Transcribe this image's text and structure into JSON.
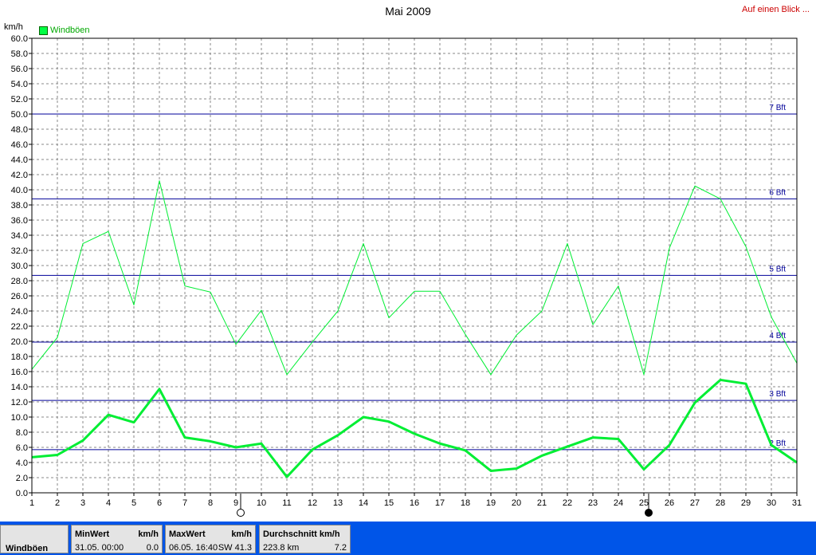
{
  "title": "Mai 2009",
  "link_label": "Auf einen Blick ...",
  "unit_label": "km/h",
  "legend_label": "Windböen",
  "footer": {
    "name": "Windböen",
    "min": {
      "header": "MinWert",
      "unit": "km/h",
      "date": "31.05.  00:00",
      "value": "0.0"
    },
    "max": {
      "header": "MaxWert",
      "unit": "km/h",
      "date": "06.05.  16:40",
      "value": "SW 41.3"
    },
    "avg": {
      "header": "Durchschnitt km/h",
      "distance": "223.8 km",
      "value": "7.2"
    }
  },
  "colors": {
    "series": "#00ee33",
    "beaufort": "#000099",
    "grid": "#777777",
    "footer": "#0055e8"
  },
  "moon_icons": [
    "full-moon-icon",
    "new-moon-icon"
  ],
  "chart_data": {
    "type": "line",
    "title": "Mai 2009",
    "ylabel": "km/h",
    "ylim": [
      0,
      60
    ],
    "y_ticks": [
      "0.0",
      "2.0",
      "4.0",
      "6.0",
      "8.0",
      "10.0",
      "12.0",
      "14.0",
      "16.0",
      "18.0",
      "20.0",
      "22.0",
      "24.0",
      "26.0",
      "28.0",
      "30.0",
      "32.0",
      "34.0",
      "36.0",
      "38.0",
      "40.0",
      "42.0",
      "44.0",
      "46.0",
      "48.0",
      "50.0",
      "52.0",
      "54.0",
      "56.0",
      "58.0",
      "60.0"
    ],
    "x": [
      1,
      2,
      3,
      4,
      5,
      6,
      7,
      8,
      9,
      10,
      11,
      12,
      13,
      14,
      15,
      16,
      17,
      18,
      19,
      20,
      21,
      22,
      23,
      24,
      25,
      26,
      27,
      28,
      29,
      30,
      31
    ],
    "grid": true,
    "series": [
      {
        "name": "Windböen",
        "style": "thin",
        "values": [
          16.3,
          20.5,
          32.9,
          34.5,
          24.8,
          41.2,
          27.3,
          26.5,
          19.6,
          24.1,
          15.6,
          19.9,
          24.0,
          32.9,
          23.1,
          26.6,
          26.6,
          20.9,
          15.6,
          20.8,
          24.0,
          32.9,
          22.2,
          27.3,
          15.6,
          32.3,
          40.5,
          38.8,
          32.5,
          23.2,
          17.1
        ]
      },
      {
        "style": "thick",
        "values": [
          4.7,
          5.0,
          6.9,
          10.3,
          9.3,
          13.7,
          7.3,
          6.8,
          6.0,
          6.5,
          2.1,
          5.7,
          7.6,
          10.0,
          9.4,
          7.8,
          6.5,
          5.6,
          2.9,
          3.2,
          4.9,
          6.1,
          7.3,
          7.1,
          3.1,
          6.3,
          11.9,
          14.9,
          14.4,
          6.3,
          4.0
        ]
      }
    ],
    "beaufort_lines": [
      {
        "label": "2 Bft",
        "value": 5.7
      },
      {
        "label": "3 Bft",
        "value": 12.2
      },
      {
        "label": "4 Bft",
        "value": 19.9
      },
      {
        "label": "5 Bft",
        "value": 28.7
      },
      {
        "label": "6 Bft",
        "value": 38.8
      },
      {
        "label": "7 Bft",
        "value": 50.0
      }
    ],
    "moon_markers": [
      {
        "day": 9,
        "phase": "full"
      },
      {
        "day": 25,
        "phase": "new"
      }
    ]
  }
}
